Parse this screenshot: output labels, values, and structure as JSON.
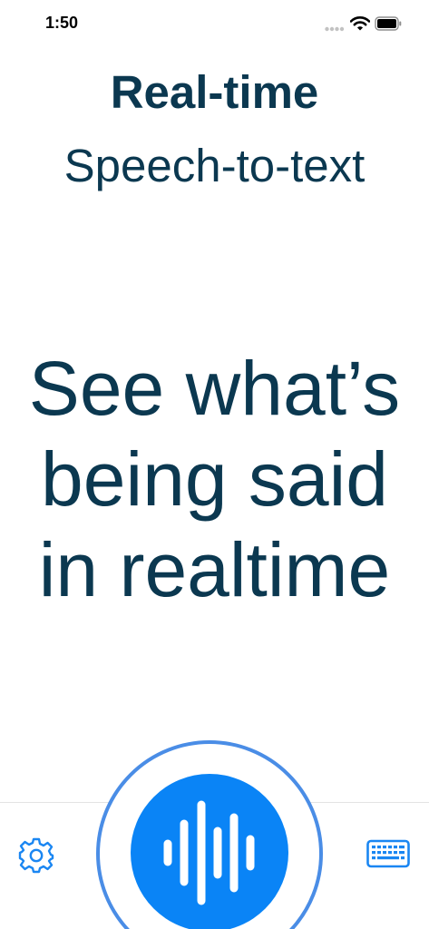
{
  "status_bar": {
    "time": "1:50",
    "icons": [
      "signal-icon",
      "wifi-icon",
      "battery-icon"
    ]
  },
  "header": {
    "title": "Real-time",
    "subtitle": "Speech-to-text"
  },
  "main": {
    "headline_lines": [
      "See what’s",
      "being said",
      "in realtime"
    ]
  },
  "bottom_bar": {
    "left_icon": "gear-icon",
    "center_icon": "waveform-icon",
    "right_icon": "keyboard-icon"
  },
  "colors": {
    "text": "#0b3850",
    "accent": "#0a84f6",
    "ring": "#4a8de6"
  }
}
